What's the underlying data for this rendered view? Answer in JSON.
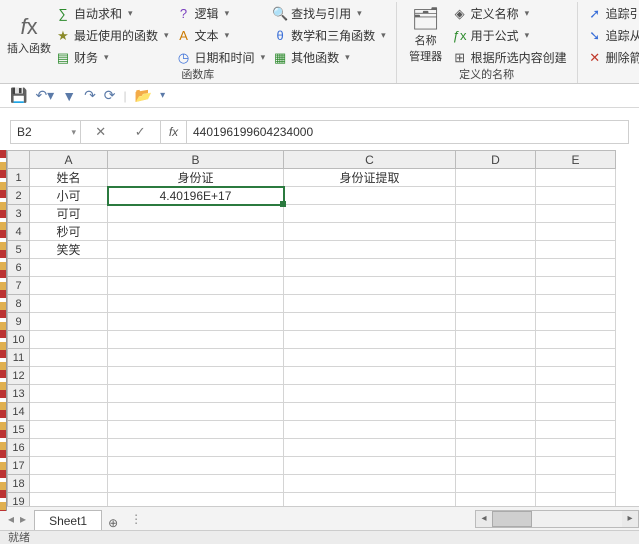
{
  "ribbon": {
    "insert_fn_label": "插入函数",
    "lib_group_label": "函数库",
    "name_group_label": "定义的名称",
    "lib": {
      "autosum": "自动求和",
      "recent": "最近使用的函数",
      "financial": "财务",
      "logical": "逻辑",
      "text": "文本",
      "datetime": "日期和时间",
      "lookup": "查找与引用",
      "mathtrig": "数学和三角函数",
      "other": "其他函数"
    },
    "name_mgr_label": "名称\n管理器",
    "names": {
      "define": "定义名称",
      "usein": "用于公式",
      "create": "根据所选内容创建"
    },
    "audit": {
      "trace_prec": "追踪引",
      "trace_dep": "追踪从",
      "remove": "删除箭"
    }
  },
  "formula_bar": {
    "cell_ref": "B2",
    "value": "440196199604234000"
  },
  "grid": {
    "cols": [
      "A",
      "B",
      "C",
      "D",
      "E"
    ],
    "rows": 19,
    "cells": {
      "A1": "姓名",
      "B1": "身份证",
      "C1": "身份证提取",
      "A2": "小可",
      "B2": "4.40196E+17",
      "A3": "可可",
      "A4": "秒可",
      "A5": "笑笑"
    },
    "selected": "B2"
  },
  "sheet_tabs": {
    "active": "Sheet1"
  },
  "status": {
    "text": "就绪"
  }
}
